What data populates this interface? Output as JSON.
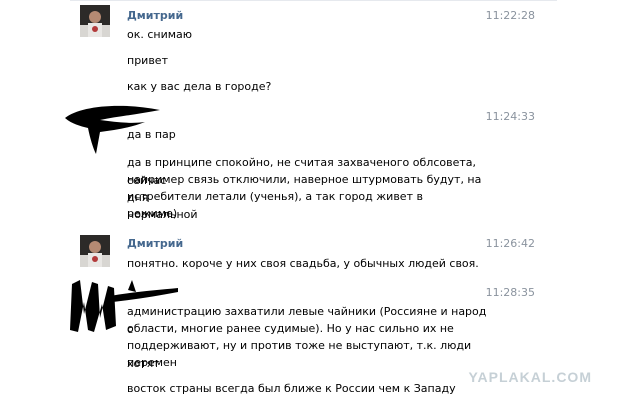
{
  "messages": [
    {
      "sender": "Дмитрий",
      "time": "11:22:28",
      "lines": [
        "ок. снимаю",
        "привет",
        "как у вас дела в городе?"
      ]
    },
    {
      "sender": "",
      "time": "11:24:33",
      "lines": [
        "да в пар",
        "да в принципе спокойно, не считая захваченого облсовета, сейчас",
        "например связь отключили, наверное штурмовать будут, на дня",
        "истребители летали (ученья), а так город живет в нормальной",
        "режиме)"
      ]
    },
    {
      "sender": "Дмитрий",
      "time": "11:26:42",
      "lines": [
        "понятно. короче у них своя свадьба, у обычных людей своя."
      ]
    },
    {
      "sender": "",
      "time": "11:28:35",
      "lines": [
        "администрацию захватили левые чайники (Россияне и народ с",
        "области, многие ранее судимые). Но у нас сильно их не",
        "поддерживают, ну и против тоже не выступают, т.к. люди хотят",
        "перемен",
        "восток страны всегда был ближе к России чем к Западу"
      ]
    }
  ],
  "watermark": "YAPLAKAL.COM",
  "colors": {
    "sender": "#45688e",
    "time": "#8a939e",
    "watermark": "#c6d0d6"
  }
}
